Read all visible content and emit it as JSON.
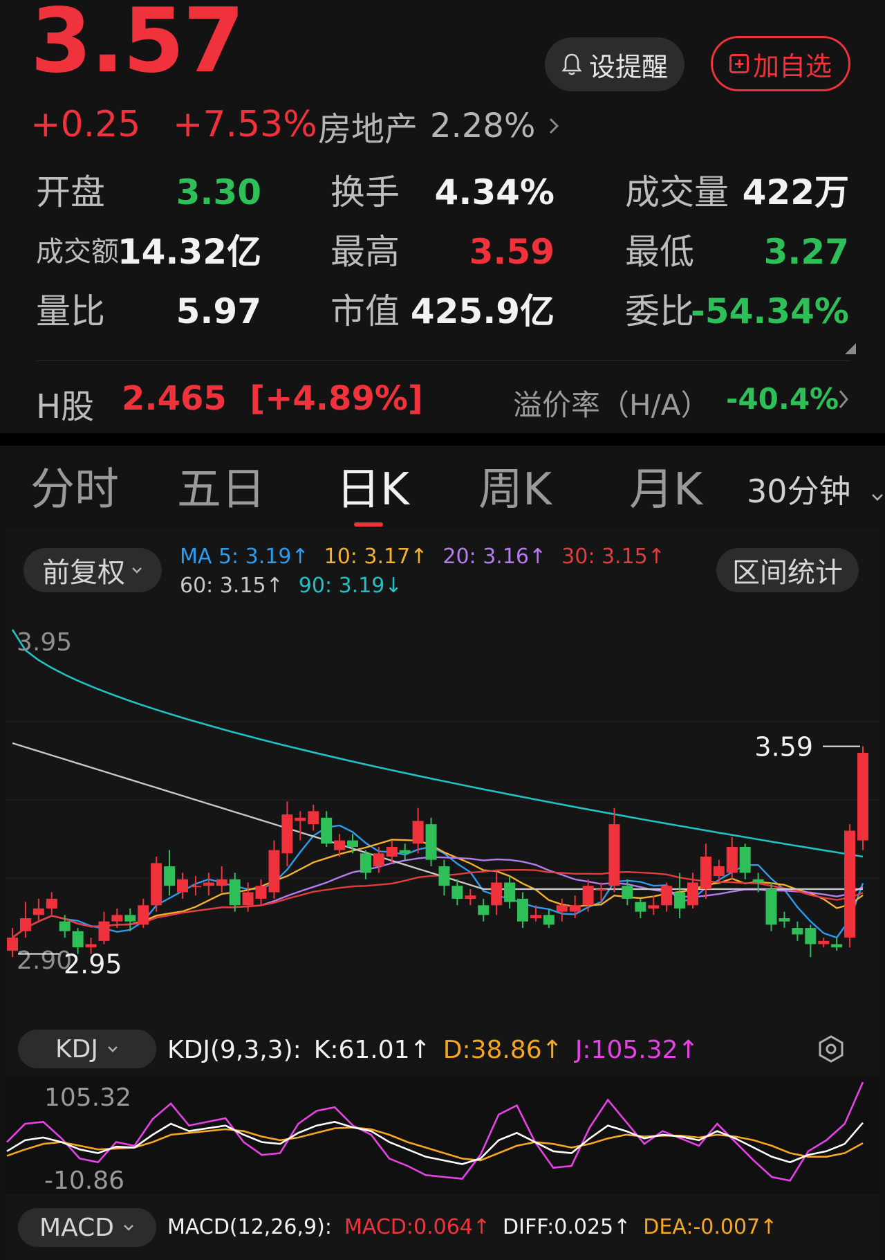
{
  "quote": {
    "price": "3.57",
    "change": "+0.25",
    "change_pct": "+7.53%",
    "sector_name": "房地产",
    "sector_pct": "2.28%",
    "sector_chevron": "chevron-right-icon"
  },
  "actions": {
    "alert_label": "设提醒",
    "alert_icon": "bell-icon",
    "watch_label": "加自选",
    "watch_icon": "plus-square-icon"
  },
  "stats": [
    {
      "label": "开盘",
      "value": "3.30",
      "color": "#2fbf59"
    },
    {
      "label": "换手",
      "value": "4.34%",
      "color": "#f2f2f2"
    },
    {
      "label": "成交量",
      "value": "422万",
      "color": "#f2f2f2"
    },
    {
      "label": "成交额",
      "value": "14.32亿",
      "color": "#f2f2f2"
    },
    {
      "label": "最高",
      "value": "3.59",
      "color": "#f0323c"
    },
    {
      "label": "最低",
      "value": "3.27",
      "color": "#2fbf59"
    },
    {
      "label": "量比",
      "value": "5.97",
      "color": "#f2f2f2"
    },
    {
      "label": "市值",
      "value": "425.9亿",
      "color": "#f2f2f2"
    },
    {
      "label": "委比",
      "value": "-54.34%",
      "color": "#2fbf59"
    }
  ],
  "h_share": {
    "label": "H股",
    "value": "2.465  [+4.89%]",
    "premium_label": "溢价率（H/A）",
    "premium_value": "-40.4%"
  },
  "tabs": [
    "分时",
    "五日",
    "日K",
    "周K",
    "月K"
  ],
  "active_tab": "日K",
  "tab_more": "30分钟",
  "adjust_label": "前复权",
  "range_stats_label": "区间统计",
  "ma_legend": [
    {
      "text": "MA 5: 3.19↑",
      "color": "#2d9cf0"
    },
    {
      "text": "10: 3.17↑",
      "color": "#f5b02e"
    },
    {
      "text": "20: 3.16↑",
      "color": "#b57cf0"
    },
    {
      "text": "30: 3.15↑",
      "color": "#e23c3c"
    },
    {
      "text": "60: 3.15↑",
      "color": "#c8c8c8"
    },
    {
      "text": "90: 3.19↓",
      "color": "#22c1c3"
    }
  ],
  "kdj": {
    "selector": "KDJ",
    "params": "KDJ(9,3,3):",
    "k": "K:61.01↑",
    "d": "D:38.86↑",
    "j": "J:105.32↑",
    "settings_icon": "hexagon-settings-icon"
  },
  "macd": {
    "selector": "MACD",
    "params": "MACD(12,26,9):",
    "macd": "MACD:0.064↑",
    "diff": "DIFF:0.025↑",
    "dea": "DEA:-0.007↑"
  },
  "chart_data": [
    {
      "type": "candlestick",
      "title": "日K",
      "ylim": [
        2.9,
        3.95
      ],
      "y_axis_labels": [
        "3.95",
        "2.90"
      ],
      "high_label": "3.59",
      "low_label": "2.95",
      "candles": [
        [
          2.96,
          3.0,
          2.94,
          3.03
        ],
        [
          3.02,
          3.06,
          3.0,
          3.11
        ],
        [
          3.07,
          3.09,
          3.05,
          3.12
        ],
        [
          3.09,
          3.12,
          3.07,
          3.14
        ],
        [
          3.05,
          3.02,
          3.0,
          3.07
        ],
        [
          3.02,
          2.97,
          2.95,
          3.03
        ],
        [
          2.97,
          2.98,
          2.95,
          3.0
        ],
        [
          2.99,
          3.05,
          2.98,
          3.08
        ],
        [
          3.05,
          3.07,
          3.03,
          3.09
        ],
        [
          3.07,
          3.05,
          3.02,
          3.09
        ],
        [
          3.04,
          3.1,
          3.03,
          3.12
        ],
        [
          3.1,
          3.23,
          3.08,
          3.25
        ],
        [
          3.22,
          3.16,
          3.13,
          3.27
        ],
        [
          3.14,
          3.18,
          3.12,
          3.2
        ],
        [
          3.16,
          3.16,
          3.13,
          3.19
        ],
        [
          3.16,
          3.17,
          3.13,
          3.2
        ],
        [
          3.16,
          3.18,
          3.14,
          3.22
        ],
        [
          3.18,
          3.1,
          3.08,
          3.2
        ],
        [
          3.1,
          3.14,
          3.08,
          3.17
        ],
        [
          3.12,
          3.16,
          3.1,
          3.18
        ],
        [
          3.14,
          3.27,
          3.12,
          3.3
        ],
        [
          3.26,
          3.38,
          3.22,
          3.42
        ],
        [
          3.36,
          3.37,
          3.3,
          3.39
        ],
        [
          3.35,
          3.39,
          3.33,
          3.41
        ],
        [
          3.37,
          3.29,
          3.28,
          3.39
        ],
        [
          3.27,
          3.3,
          3.25,
          3.32
        ],
        [
          3.3,
          3.28,
          3.26,
          3.32
        ],
        [
          3.26,
          3.2,
          3.18,
          3.27
        ],
        [
          3.22,
          3.26,
          3.2,
          3.28
        ],
        [
          3.25,
          3.28,
          3.23,
          3.3
        ],
        [
          3.27,
          3.26,
          3.24,
          3.29
        ],
        [
          3.29,
          3.36,
          3.26,
          3.4
        ],
        [
          3.35,
          3.24,
          3.22,
          3.37
        ],
        [
          3.22,
          3.16,
          3.13,
          3.24
        ],
        [
          3.16,
          3.12,
          3.1,
          3.18
        ],
        [
          3.12,
          3.13,
          3.1,
          3.15
        ],
        [
          3.1,
          3.07,
          3.05,
          3.12
        ],
        [
          3.1,
          3.17,
          3.07,
          3.21
        ],
        [
          3.17,
          3.11,
          3.09,
          3.19
        ],
        [
          3.12,
          3.05,
          3.03,
          3.14
        ],
        [
          3.06,
          3.07,
          3.05,
          3.1
        ],
        [
          3.07,
          3.04,
          3.03,
          3.09
        ],
        [
          3.08,
          3.1,
          3.05,
          3.12
        ],
        [
          3.08,
          3.1,
          3.06,
          3.13
        ],
        [
          3.1,
          3.16,
          3.08,
          3.18
        ],
        [
          3.15,
          3.15,
          3.11,
          3.17
        ],
        [
          3.16,
          3.35,
          3.14,
          3.4
        ],
        [
          3.16,
          3.12,
          3.1,
          3.18
        ],
        [
          3.11,
          3.08,
          3.06,
          3.12
        ],
        [
          3.09,
          3.1,
          3.07,
          3.13
        ],
        [
          3.1,
          3.16,
          3.08,
          3.17
        ],
        [
          3.14,
          3.09,
          3.06,
          3.2
        ],
        [
          3.1,
          3.17,
          3.09,
          3.2
        ],
        [
          3.15,
          3.25,
          3.12,
          3.29
        ],
        [
          3.19,
          3.22,
          3.17,
          3.24
        ],
        [
          3.2,
          3.28,
          3.18,
          3.31
        ],
        [
          3.28,
          3.2,
          3.18,
          3.29
        ],
        [
          3.18,
          3.17,
          3.14,
          3.2
        ],
        [
          3.15,
          3.04,
          3.02,
          3.17
        ],
        [
          3.06,
          3.05,
          3.03,
          3.08
        ],
        [
          3.03,
          3.01,
          2.99,
          3.05
        ],
        [
          3.03,
          2.98,
          2.94,
          3.04
        ],
        [
          2.98,
          2.99,
          2.97,
          3.0
        ],
        [
          2.98,
          2.97,
          2.96,
          3.0
        ],
        [
          3.0,
          3.33,
          2.97,
          3.35
        ],
        [
          3.3,
          3.57,
          3.27,
          3.59
        ]
      ]
    },
    {
      "type": "line",
      "title": "KDJ(9,3,3)",
      "ylim": [
        -10.86,
        105.32
      ],
      "y_axis_labels": [
        "105.32",
        "-10.86"
      ],
      "series": [
        {
          "name": "K",
          "color": "#ffffff",
          "values": [
            30,
            42,
            45,
            40,
            32,
            28,
            35,
            34,
            48,
            60,
            52,
            55,
            58,
            48,
            40,
            38,
            50,
            58,
            62,
            56,
            52,
            40,
            32,
            24,
            20,
            16,
            22,
            42,
            50,
            40,
            30,
            28,
            44,
            58,
            52,
            44,
            48,
            46,
            42,
            52,
            44,
            34,
            24,
            18,
            26,
            30,
            38,
            61
          ]
        },
        {
          "name": "D",
          "color": "#f5a623",
          "values": [
            25,
            32,
            38,
            40,
            36,
            32,
            33,
            34,
            40,
            48,
            50,
            52,
            54,
            52,
            46,
            42,
            45,
            50,
            55,
            56,
            54,
            48,
            40,
            34,
            28,
            22,
            20,
            28,
            36,
            40,
            38,
            34,
            38,
            44,
            48,
            46,
            47,
            47,
            45,
            48,
            46,
            42,
            36,
            28,
            24,
            24,
            28,
            38.86
          ]
        },
        {
          "name": "J",
          "color": "#e642e6",
          "values": [
            40,
            60,
            62,
            44,
            22,
            18,
            40,
            36,
            65,
            82,
            58,
            62,
            66,
            40,
            26,
            28,
            60,
            74,
            78,
            58,
            48,
            22,
            14,
            4,
            2,
            0,
            26,
            70,
            80,
            40,
            12,
            14,
            56,
            86,
            62,
            38,
            52,
            44,
            36,
            60,
            40,
            20,
            2,
            -2,
            30,
            42,
            60,
            105.32
          ]
        }
      ]
    }
  ]
}
